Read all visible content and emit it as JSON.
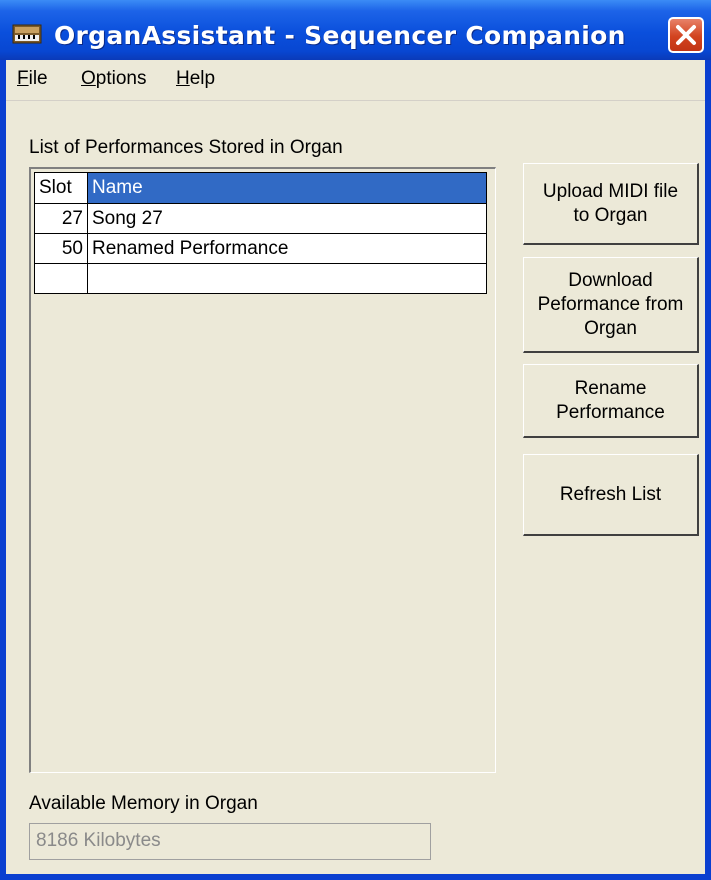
{
  "window": {
    "title": "OrganAssistant - Sequencer Companion",
    "app_icon": "organ-icon",
    "close_icon": "close-icon"
  },
  "menu": {
    "file": {
      "first": "F",
      "rest": "ile"
    },
    "options": {
      "first": "O",
      "rest": "ptions"
    },
    "help": {
      "first": "H",
      "rest": "elp"
    }
  },
  "list": {
    "label": "List of Performances Stored in Organ",
    "columns": {
      "slot": "Slot",
      "name": "Name"
    },
    "rows": [
      {
        "slot": "27",
        "name": "Song 27"
      },
      {
        "slot": "50",
        "name": "Renamed Performance"
      },
      {
        "slot": "",
        "name": ""
      }
    ]
  },
  "buttons": {
    "upload": "Upload MIDI file\nto Organ",
    "download": "Download\nPeformance from\nOrgan",
    "rename": "Rename\nPerformance",
    "refresh": "Refresh List"
  },
  "memory": {
    "label": "Available Memory in Organ",
    "value": "8186 Kilobytes"
  },
  "colors": {
    "titlebar": "#0a4fdc",
    "selection": "#316ac5",
    "close": "#d2431f",
    "face": "#ece9d8"
  }
}
